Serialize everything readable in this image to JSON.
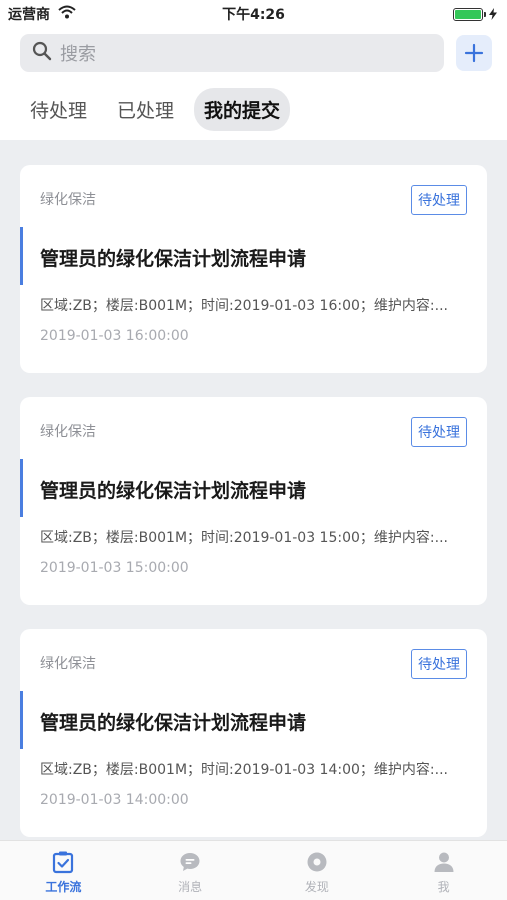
{
  "status_bar": {
    "carrier": "运营商",
    "time": "下午4:26",
    "battery_level": 1.0
  },
  "search": {
    "placeholder": "搜索"
  },
  "tabs": [
    {
      "label": "待处理",
      "active": false
    },
    {
      "label": "已处理",
      "active": false
    },
    {
      "label": "我的提交",
      "active": true
    }
  ],
  "cards": [
    {
      "category": "绿化保洁",
      "status": "待处理",
      "title": "管理员的绿化保洁计划流程申请",
      "description": "区域:ZB；楼层:B001M；时间:2019-01-03 16:00；维护内容:...",
      "time": "2019-01-03 16:00:00"
    },
    {
      "category": "绿化保洁",
      "status": "待处理",
      "title": "管理员的绿化保洁计划流程申请",
      "description": "区域:ZB；楼层:B001M；时间:2019-01-03 15:00；维护内容:...",
      "time": "2019-01-03 15:00:00"
    },
    {
      "category": "绿化保洁",
      "status": "待处理",
      "title": "管理员的绿化保洁计划流程申请",
      "description": "区域:ZB；楼层:B001M；时间:2019-01-03 14:00；维护内容:...",
      "time": "2019-01-03 14:00:00"
    }
  ],
  "tab_bar": [
    {
      "label": "工作流",
      "icon": "workflow-icon",
      "active": true
    },
    {
      "label": "消息",
      "icon": "message-icon",
      "active": false
    },
    {
      "label": "发现",
      "icon": "discover-icon",
      "active": false
    },
    {
      "label": "我",
      "icon": "profile-icon",
      "active": false
    }
  ],
  "colors": {
    "accent": "#3a73dc",
    "background": "#eceef1"
  }
}
